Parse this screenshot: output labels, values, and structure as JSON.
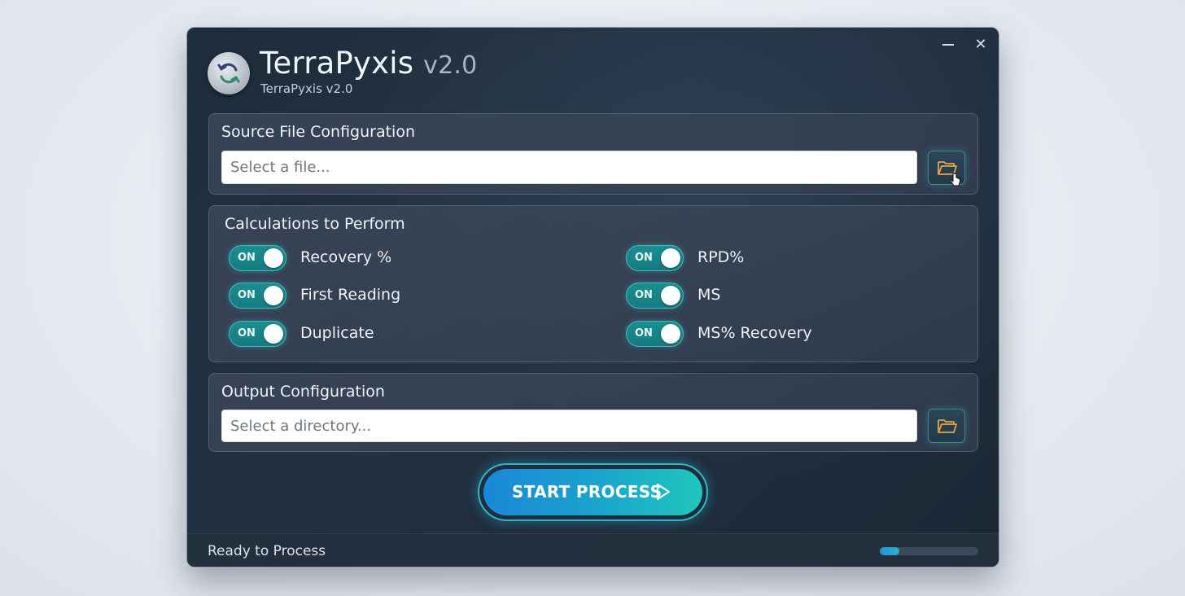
{
  "window": {
    "title_main": "TerraPyxis",
    "title_version": "v2.0",
    "subtitle": "TerraPyxis v2.0",
    "minimize_icon": "minimize-icon",
    "close_icon": "close-icon",
    "close_glyph": "✕",
    "logo_icon": "refresh-sync-icon"
  },
  "source": {
    "title": "Source File Configuration",
    "placeholder": "Select a file...",
    "value": "",
    "browse_icon": "folder-open-icon"
  },
  "calculations": {
    "title": "Calculations to Perform",
    "items": [
      {
        "label": "Recovery %",
        "state": "ON"
      },
      {
        "label": "First Reading",
        "state": "ON"
      },
      {
        "label": "Duplicate",
        "state": "ON"
      },
      {
        "label": "RPD%",
        "state": "ON"
      },
      {
        "label": "MS",
        "state": "ON"
      },
      {
        "label": "MS% Recovery",
        "state": "ON"
      }
    ]
  },
  "output": {
    "title": "Output Configuration",
    "placeholder": "Select a directory...",
    "value": "",
    "browse_icon": "folder-open-icon"
  },
  "actions": {
    "start_label": "START PROCESS",
    "start_icon": "play-icon"
  },
  "status": {
    "text": "Ready to Process",
    "progress_fraction": 0.2
  },
  "colors": {
    "accent_teal": "#1a8e91",
    "accent_blue": "#1b86d8",
    "folder_orange": "#e8a24a",
    "window_bg": "#1e2d3b"
  }
}
